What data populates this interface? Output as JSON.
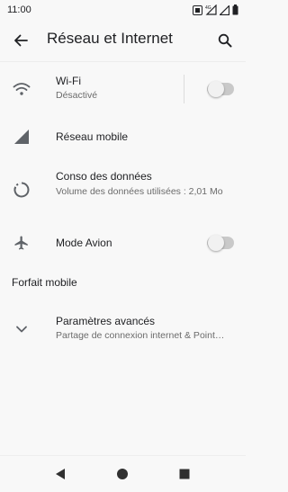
{
  "status_bar": {
    "time": "11:00",
    "icons": [
      "sim-card-icon",
      "mobile-data-signal-icon",
      "signal-icon",
      "battery-icon"
    ]
  },
  "app_bar": {
    "title": "Réseau et Internet",
    "icons": [
      "back-arrow-icon",
      "search-icon"
    ]
  },
  "items": [
    {
      "icon": "wifi-icon",
      "label": "Wi-Fi",
      "sub": "Désactivé",
      "toggle": false
    },
    {
      "icon": "cell-signal-icon",
      "label": "Réseau mobile"
    },
    {
      "icon": "data-usage-icon",
      "label": "Conso des données",
      "sub": "Volume des données utilisées : 2,01 Mo"
    },
    {
      "icon": "airplane-icon",
      "label": "Mode Avion",
      "toggle": false
    }
  ],
  "section": {
    "title": "Forfait mobile"
  },
  "advanced": {
    "icon": "chevron-down-icon",
    "label": "Paramètres avancés",
    "sub": "Partage de connexion internet & Point…"
  },
  "nav": {
    "icons": [
      "back-triangle-icon",
      "home-circle-icon",
      "recents-square-icon"
    ]
  },
  "colors": {
    "background": "#f8f8f8",
    "text": "#202124",
    "secondary_text": "#6b6b6b",
    "icon": "#5f6368",
    "toggle_track": "#c9c9c9"
  }
}
